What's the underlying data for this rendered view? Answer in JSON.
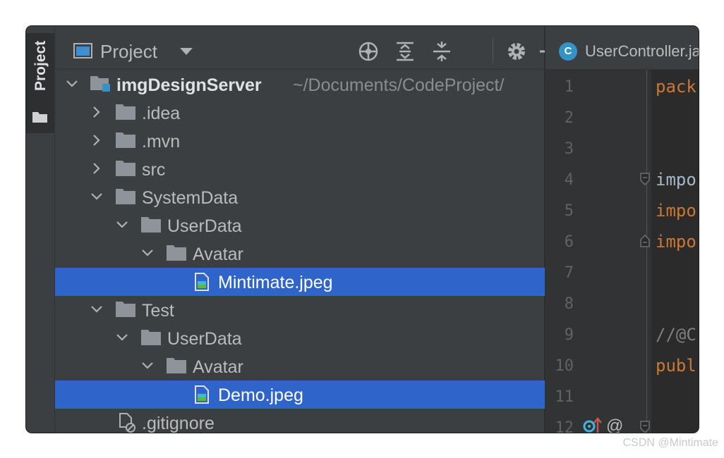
{
  "toolwindow": {
    "tab_label": "Project"
  },
  "panel": {
    "title": "Project",
    "toolbar_icons": [
      "locate-icon",
      "expand-all-icon",
      "collapse-all-icon",
      "gear-icon",
      "minimize-icon"
    ]
  },
  "tree": {
    "root": {
      "name": "imgDesignServer",
      "path": "~/Documents/CodeProject/"
    },
    "items": [
      {
        "label": ".idea"
      },
      {
        "label": ".mvn"
      },
      {
        "label": "src"
      },
      {
        "label": "SystemData"
      },
      {
        "label": "UserData"
      },
      {
        "label": "Avatar"
      },
      {
        "label": "Mintimate.jpeg"
      },
      {
        "label": "Test"
      },
      {
        "label": "UserData"
      },
      {
        "label": "Avatar"
      },
      {
        "label": "Demo.jpeg"
      },
      {
        "label": ".gitignore"
      }
    ]
  },
  "editor": {
    "tab_icon_letter": "C",
    "tab_title": "UserController.ja",
    "line_numbers": [
      "1",
      "2",
      "3",
      "4",
      "5",
      "6",
      "7",
      "8",
      "9",
      "10",
      "11",
      "12"
    ],
    "code": {
      "l1": "pack",
      "l4": "impo",
      "l5": "impo",
      "l6": "impo",
      "l9": "//@C",
      "l10": "publ",
      "l12_at": "@"
    }
  },
  "watermark": "CSDN @Mintimate",
  "colors": {
    "selection": "#2f65ca",
    "keyword": "#cc7832",
    "panel_bg": "#3c3f41",
    "editor_bg": "#2b2b2b"
  }
}
